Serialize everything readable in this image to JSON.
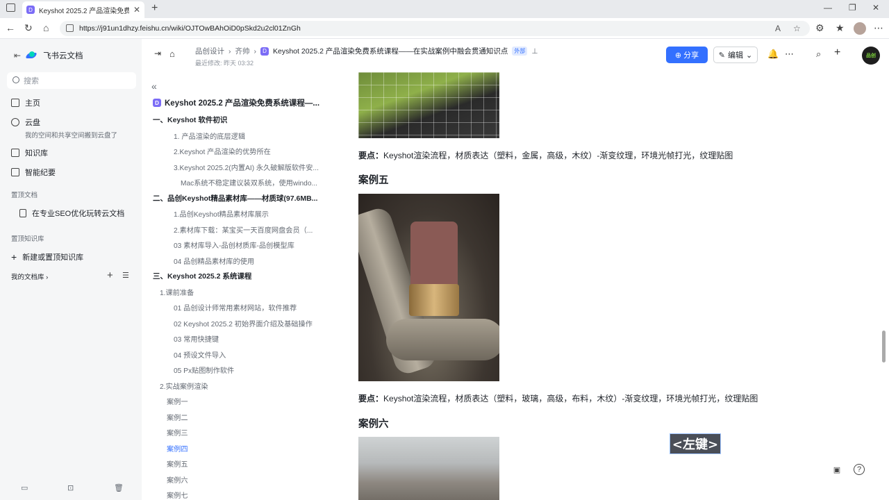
{
  "browser": {
    "tab_title": "Keyshot 2025.2 产品渲染免费系统",
    "tab_favicon": "D",
    "url": "https://j91un1dhzy.feishu.cn/wiki/OJTOwBAhOiD0pSkd2u2cl01ZnGh"
  },
  "sidebar": {
    "app_name": "飞书云文档",
    "search_placeholder": "搜索",
    "items": [
      {
        "label": "主页",
        "icon": "home-icon"
      },
      {
        "label": "云盘",
        "icon": "cloud-drive-icon"
      },
      {
        "label": "知识库",
        "icon": "wiki-icon"
      },
      {
        "label": "智能纪要",
        "icon": "notes-icon"
      }
    ],
    "cloud_sub": "我的空间和共享空间搬到云盘了",
    "pinned_docs_title": "置顶文档",
    "pinned_doc": "在专业SEO优化玩转云文档",
    "pinned_wiki_title": "置顶知识库",
    "new_wiki": "新建或置顶知识库",
    "my_docs": "我的文档库"
  },
  "header": {
    "crumb1": "品创设计",
    "crumb2": "齐帅",
    "title": "Keyshot 2025.2 产品渲染免费系统课程——在实战案例中融会贯通知识点",
    "badge": "外部",
    "edited": "最近修改: 昨天 03:32",
    "share_label": "分享",
    "edit_label": "编辑",
    "avatar_text": "品创"
  },
  "outline": {
    "title": "Keyshot 2025.2 产品渲染免费系统课程—...",
    "items": [
      {
        "text": "一、Keyshot 软件初识",
        "level": 1
      },
      {
        "text": "1. 产品渲染的底层逻辑",
        "level": 2
      },
      {
        "text": "2.Keyshot 产品渲染的优势所在",
        "level": 2
      },
      {
        "text": "3.Keyshot 2025.2(内置AI) 永久破解版软件安...",
        "level": 2
      },
      {
        "text": "Mac系统不稳定建议装双系统，使用windo...",
        "level": 3
      },
      {
        "text": "二、品创Keyshot精品素材库——材质球(97.6MB...",
        "level": 1
      },
      {
        "text": "1.品创Keyshot精品素材库展示",
        "level": 2
      },
      {
        "text": "2.素材库下载：某宝买一天百度网盘会员（...",
        "level": 2
      },
      {
        "text": "03 素材库导入-品创材质库-品创模型库",
        "level": 2
      },
      {
        "text": "04 品创精品素材库的使用",
        "level": 2
      },
      {
        "text": "三、Keyshot 2025.2 系统课程",
        "level": 1
      },
      {
        "text": "1.课前准备",
        "level": 1.5
      },
      {
        "text": "01 品创设计师常用素材网站，软件推荐",
        "level": 2
      },
      {
        "text": "02 Keyshot 2025.2 初始界面介绍及基础操作",
        "level": 2
      },
      {
        "text": "03 常用快捷键",
        "level": 2
      },
      {
        "text": "04 预设文件导入",
        "level": 2
      },
      {
        "text": "05 Px贴图制作软件",
        "level": 2
      },
      {
        "text": "2.实战案例渲染",
        "level": 1.5
      },
      {
        "text": "案例一",
        "level": 1.7
      },
      {
        "text": "案例二",
        "level": 1.7
      },
      {
        "text": "案例三",
        "level": 1.7
      },
      {
        "text": "案例四",
        "level": 1.7,
        "active": true
      },
      {
        "text": "案例五",
        "level": 1.7
      },
      {
        "text": "案例六",
        "level": 1.7
      },
      {
        "text": "案例七",
        "level": 1.7
      }
    ]
  },
  "content": {
    "keypoint_label": "要点：",
    "keypoint1": "Keyshot渲染流程，材质表达（塑料，金属，高级，木纹）-渐变纹理，环境光帧打光，纹理贴图",
    "case5_title": "案例五",
    "keypoint2": "Keyshot渲染流程，材质表达（塑料，玻璃，高级，布料，木纹）-渐变纹理，环境光帧打光，纹理贴图",
    "case6_title": "案例六",
    "key_overlay": "<左键>"
  }
}
